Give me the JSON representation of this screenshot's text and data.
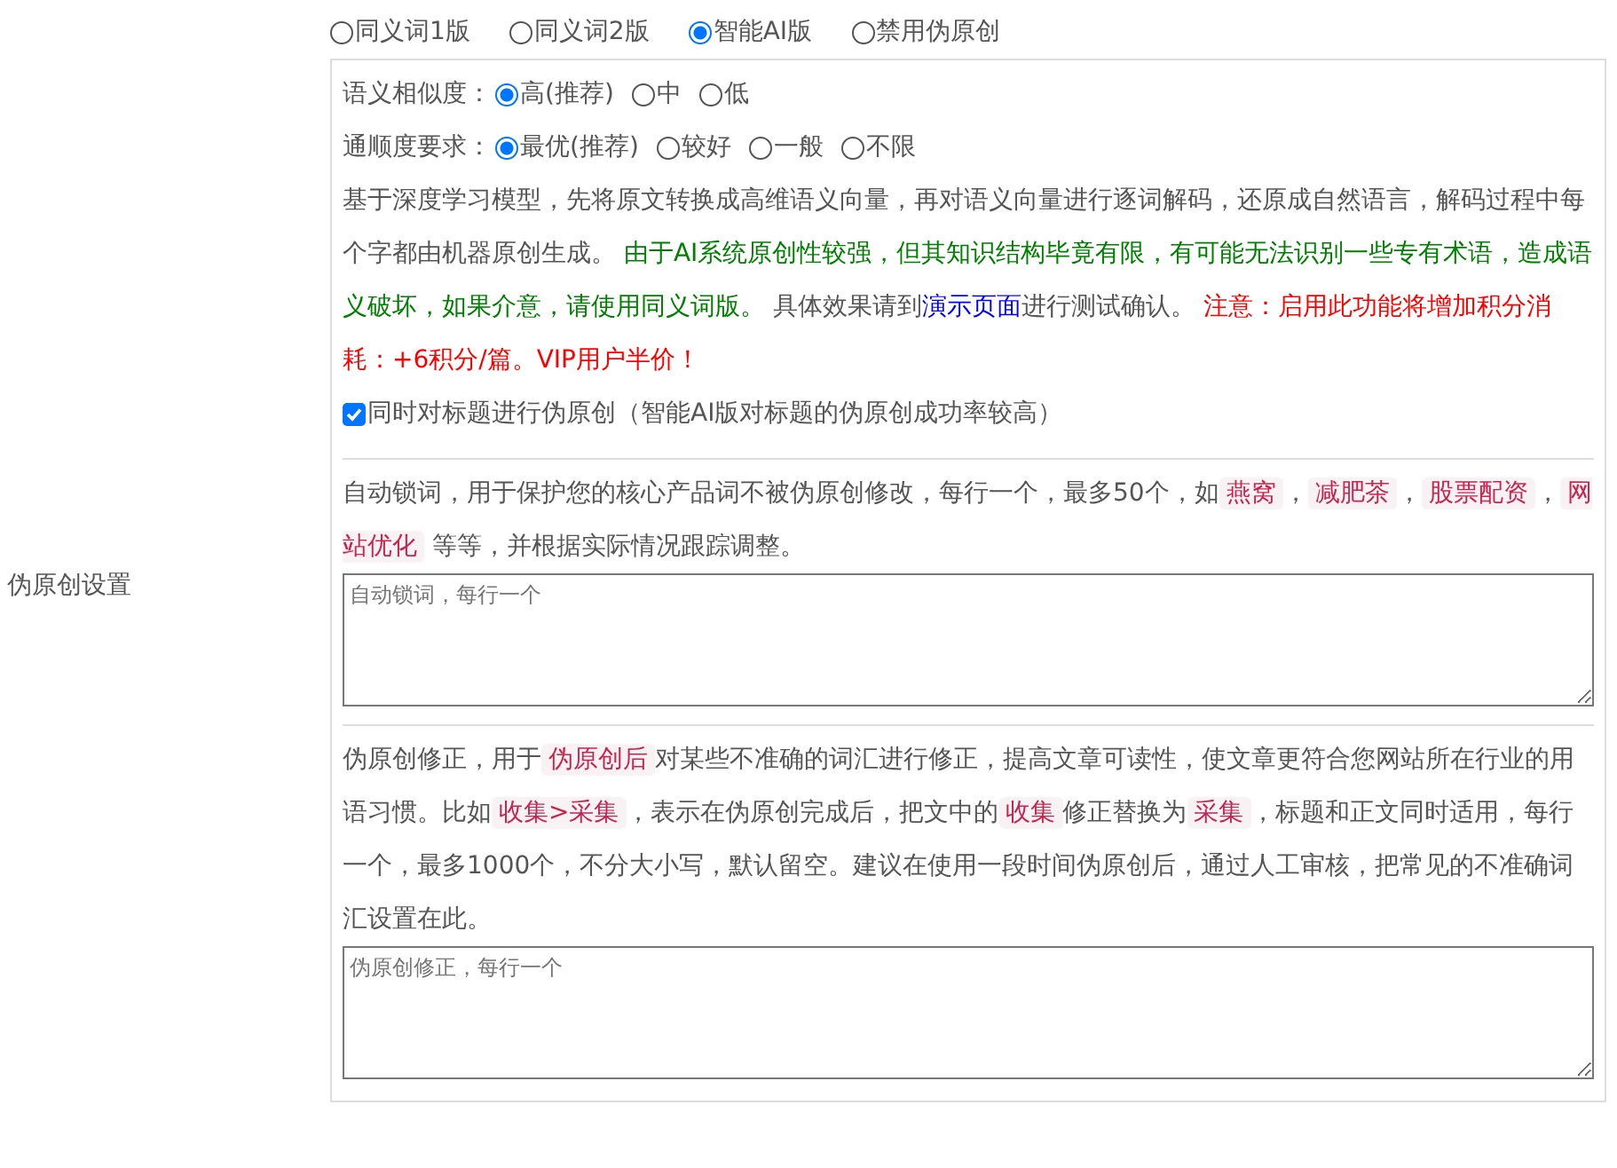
{
  "sidebar_label": "伪原创设置",
  "modes": [
    {
      "label": "同义词1版",
      "selected": false
    },
    {
      "label": "同义词2版",
      "selected": false
    },
    {
      "label": "智能AI版",
      "selected": true
    },
    {
      "label": "禁用伪原创",
      "selected": false
    }
  ],
  "similarity": {
    "label": "语义相似度：",
    "options": [
      {
        "label": "高(推荐)",
        "selected": true
      },
      {
        "label": "中",
        "selected": false
      },
      {
        "label": "低",
        "selected": false
      }
    ]
  },
  "fluency": {
    "label": "通顺度要求：",
    "options": [
      {
        "label": "最优(推荐)",
        "selected": true
      },
      {
        "label": "较好",
        "selected": false
      },
      {
        "label": "一般",
        "selected": false
      },
      {
        "label": "不限",
        "selected": false
      }
    ]
  },
  "description": [
    {
      "kind": "plain",
      "text": "基于深度学习模型，先将原文转换成高维语义向量，再对语义向量进行逐词解码，还原成自然语言，解码过程中每个字都由机器原创生成。 "
    },
    {
      "kind": "green",
      "text": "由于AI系统原创性较强，但其知识结构毕竟有限，有可能无法识别一些专有术语，造成语义破坏，如果介意，请使用同义词版。"
    },
    {
      "kind": "plain",
      "text": " 具体效果请到"
    },
    {
      "kind": "link",
      "text": "演示页面"
    },
    {
      "kind": "plain",
      "text": "进行测试确认。 "
    },
    {
      "kind": "red",
      "text": "注意：启用此功能将增加积分消耗：+6积分/篇。VIP用户半价！"
    }
  ],
  "title_option": {
    "label": "同时对标题进行伪原创（智能AI版对标题的伪原创成功率较高）",
    "checked": true
  },
  "lock_words": {
    "description": [
      {
        "kind": "plain",
        "text": "自动锁词，用于保护您的核心产品词不被伪原创修改，每行一个，最多50个，如"
      },
      {
        "kind": "tag",
        "text": "燕窝"
      },
      {
        "kind": "plain",
        "text": "，"
      },
      {
        "kind": "tag",
        "text": "减肥茶"
      },
      {
        "kind": "plain",
        "text": "，"
      },
      {
        "kind": "tag",
        "text": "股票配资"
      },
      {
        "kind": "plain",
        "text": "，"
      },
      {
        "kind": "tag",
        "text": "网站优化"
      },
      {
        "kind": "plain",
        "text": " 等等，并根据实际情况跟踪调整。"
      }
    ],
    "placeholder": "自动锁词，每行一个"
  },
  "correction": {
    "description": [
      {
        "kind": "plain",
        "text": "伪原创修正，用于"
      },
      {
        "kind": "tag",
        "text": "伪原创后"
      },
      {
        "kind": "plain",
        "text": "对某些不准确的词汇进行修正，提高文章可读性，使文章更符合您网站所在行业的用语习惯。比如"
      },
      {
        "kind": "tag",
        "text": "收集>采集"
      },
      {
        "kind": "plain",
        "text": "，表示在伪原创完成后，把文中的"
      },
      {
        "kind": "tag",
        "text": "收集"
      },
      {
        "kind": "plain",
        "text": "修正替换为"
      },
      {
        "kind": "tag",
        "text": "采集"
      },
      {
        "kind": "plain",
        "text": "，标题和正文同时适用，每行一个，最多1000个，不分大小写，默认留空。建议在使用一段时间伪原创后，通过人工审核，把常见的不准确词汇设置在此。"
      }
    ],
    "placeholder": "伪原创修正，每行一个"
  }
}
